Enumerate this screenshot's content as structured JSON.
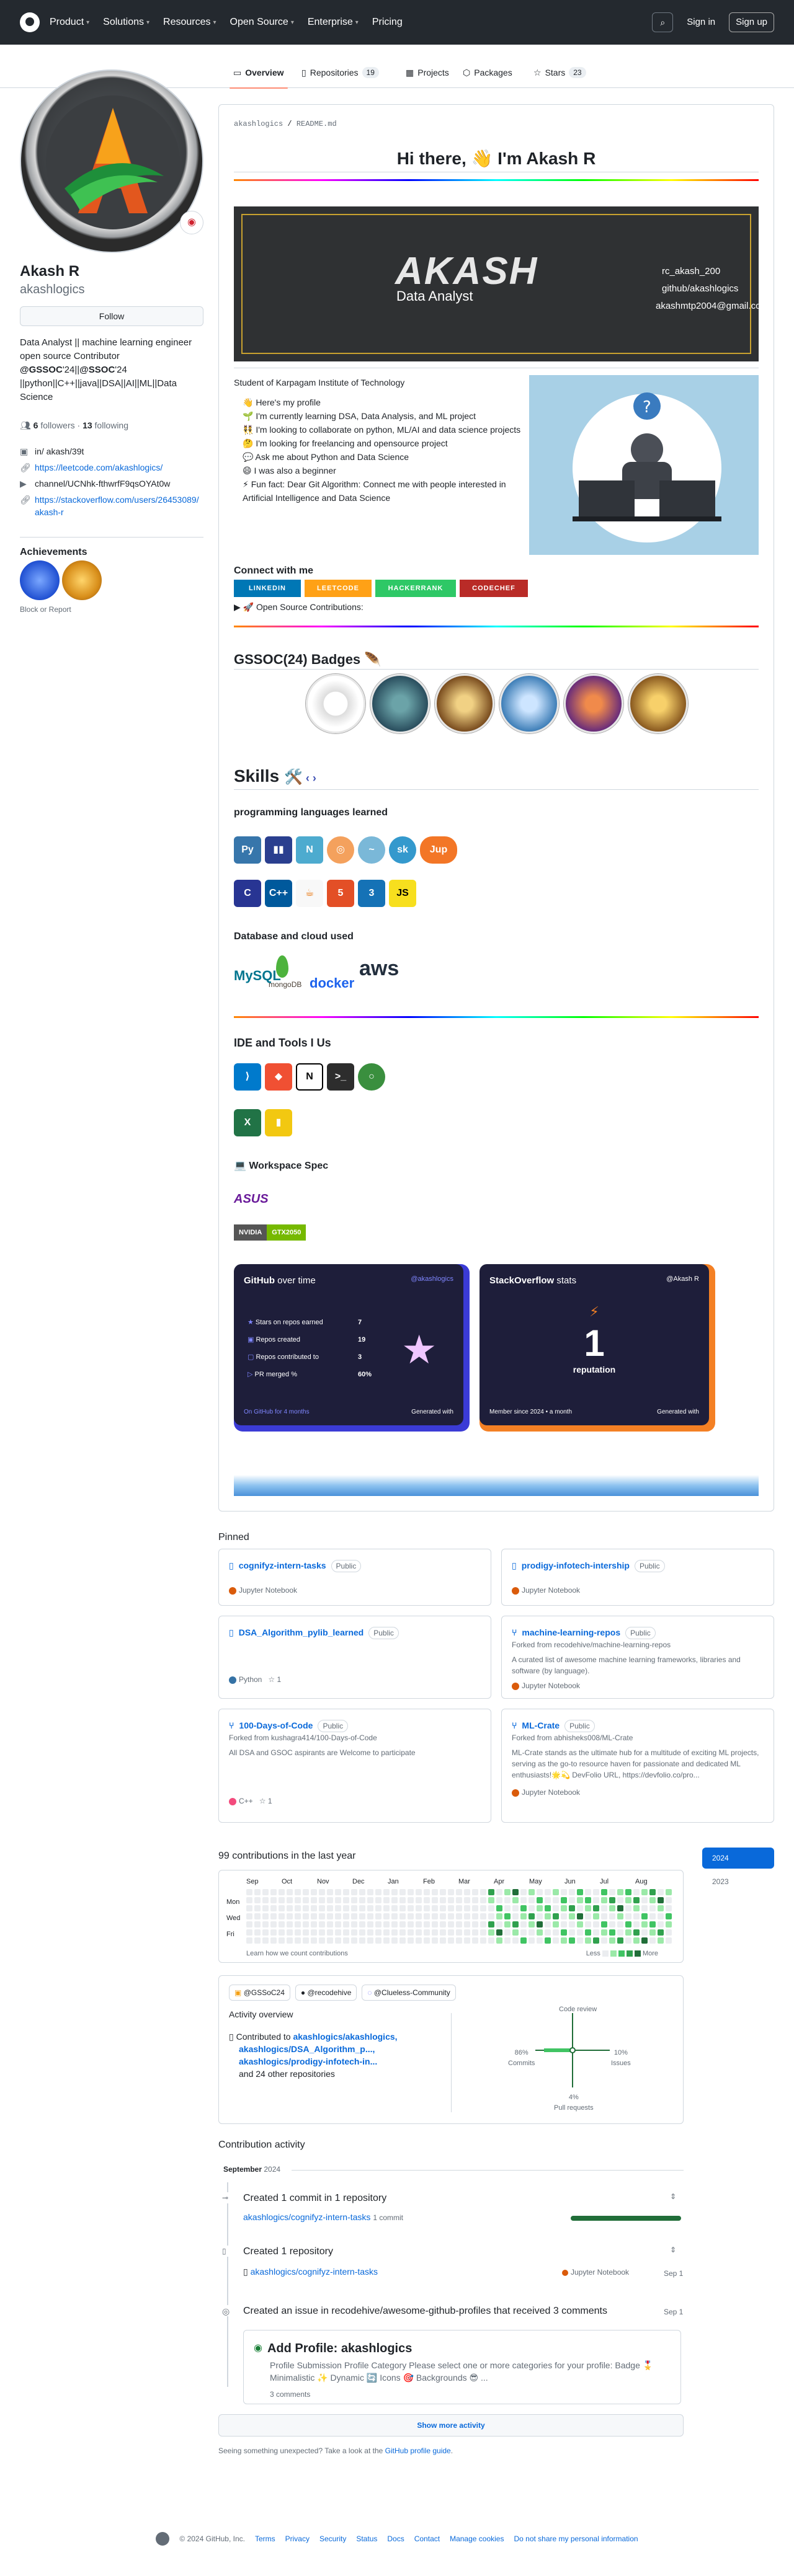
{
  "header": {
    "nav": [
      "Product",
      "Solutions",
      "Resources",
      "Open Source",
      "Enterprise",
      "Pricing"
    ],
    "sign_in": "Sign in",
    "sign_up": "Sign up"
  },
  "tabs": [
    {
      "label": "Overview"
    },
    {
      "label": "Repositories",
      "count": "19"
    },
    {
      "label": "Projects"
    },
    {
      "label": "Packages"
    },
    {
      "label": "Stars",
      "count": "23"
    }
  ],
  "profile": {
    "name": "Akash R",
    "login": "akashlogics",
    "follow": "Follow",
    "bio_l1": "Data Analyst || machine learning engineer",
    "bio_l2": "open source Contributor",
    "bio_l3a": "@GSSOC",
    "bio_l3b": "'24||",
    "bio_l3c": "@SSOC",
    "bio_l3d": "'24",
    "bio_l4": "||python||C++||java||DSA||AI||ML||Data",
    "bio_l5": "Science",
    "followers": "6",
    "followers_label": "followers",
    "following": "13",
    "following_label": "following",
    "links": [
      "in/ akash/39t",
      "https://leetcode.com/akashlogics/",
      "channel/UCNhk-fthwrfF9qsOYAt0w",
      "https://stackoverflow.com/users/26453089/",
      "akash-r"
    ],
    "achievements_title": "Achievements",
    "block": "Block or Report"
  },
  "readme": {
    "path_user": "akashlogics",
    "path_file": "README.md",
    "greeting": "Hi there,",
    "wave": "👋",
    "greeting_name": "I'm Akash R",
    "banner_name": "AKASH",
    "banner_role": "Data Analyst",
    "banner_social": [
      "rc_akash_200",
      "github/akashlogics",
      "akashmtp2004@gmail.com"
    ],
    "school": "Student of Karpagam Institute of Technology",
    "bullets": [
      "👋 Here's my profile",
      "🌱 I'm currently learning DSA, Data Analysis, and ML project",
      "👯 I'm looking to collaborate on python, ML/AI and data science projects",
      "🤔 I'm looking for freelancing and opensource project",
      "💬 Ask me about Python and Data Science",
      "😄 I was also a beginner",
      "⚡ Fun fact: Dear Git Algorithm: Connect me with people interested in Artificial Intelligence and Data Science"
    ],
    "connect": "Connect with me",
    "badges": [
      "LINKEDIN",
      "LEETCODE",
      "HACKERRANK",
      "CODECHEF"
    ],
    "osc": "▶ 🚀 Open Source Contributions:",
    "gssoc_title": "GSSOC(24) Badges",
    "skills": "Skills",
    "prog": "programming languages learned",
    "db": "Database and cloud used",
    "db_logos": [
      "MySQL",
      "mongoDB",
      "docker",
      "aws"
    ],
    "ide": "IDE and Tools I Us",
    "workspace": "💻 Workspace Spec",
    "gpu_brand": "NVIDIA",
    "gpu": "GTX2050",
    "gh_card": {
      "title": "GitHub",
      "title2": "over time",
      "user": "@akashlogics",
      "rows": [
        {
          "k": "Stars on repos earned",
          "v": "7"
        },
        {
          "k": "Repos created",
          "v": "19"
        },
        {
          "k": "Repos contributed to",
          "v": "3"
        },
        {
          "k": "PR merged %",
          "v": "60%"
        }
      ],
      "foot": "On GitHub for 4 months",
      "gen": "Generated with"
    },
    "so_card": {
      "title": "StackOverflow",
      "title2": "stats",
      "user": "@Akash R",
      "rep": "1",
      "rep_label": "reputation",
      "since": "Member since 2024 • a month",
      "gen": "Generated with"
    }
  },
  "pinned_title": "Pinned",
  "pinned": [
    {
      "name": "cognifyz-intern-tasks",
      "pub": "Public",
      "lang": "Jupyter Notebook",
      "color": "#DA5B0B"
    },
    {
      "name": "prodigy-infotech-intership",
      "pub": "Public",
      "lang": "Jupyter Notebook",
      "color": "#DA5B0B"
    },
    {
      "name": "DSA_Algorithm_pylib_learned",
      "pub": "Public",
      "lang": "Python",
      "color": "#3572A5",
      "stars": "1"
    },
    {
      "name": "machine-learning-repos",
      "pub": "Public",
      "fork": "Forked from recodehive/machine-learning-repos",
      "desc": "A curated list of awesome machine learning frameworks, libraries and software (by language).",
      "lang": "Jupyter Notebook",
      "color": "#DA5B0B"
    },
    {
      "name": "100-Days-of-Code",
      "pub": "Public",
      "fork": "Forked from kushagra414/100-Days-of-Code",
      "desc": "All DSA and GSOC aspirants are Welcome to participate",
      "lang": "C++",
      "color": "#f34b7d",
      "stars": "1"
    },
    {
      "name": "ML-Crate",
      "pub": "Public",
      "fork": "Forked from abhisheks008/ML-Crate",
      "desc": "ML-Crate stands as the ultimate hub for a multitude of exciting ML projects, serving as the go-to resource haven for passionate and dedicated ML enthusiasts!🌟💫 DevFolio URL, https://devfolio.co/pro...",
      "lang": "Jupyter Notebook",
      "color": "#DA5B0B"
    }
  ],
  "contrib": {
    "title": "99 contributions in the last year",
    "months": [
      "Sep",
      "Oct",
      "Nov",
      "Dec",
      "Jan",
      "Feb",
      "Mar",
      "Apr",
      "May",
      "Jun",
      "Jul",
      "Aug"
    ],
    "days": [
      "Mon",
      "Wed",
      "Fri"
    ],
    "learn": "Learn how we count contributions",
    "less": "Less",
    "more": "More",
    "years": [
      "2024",
      "2023"
    ]
  },
  "orgs": [
    "@GSSoC24",
    "@recodehive",
    "@Clueless-Community"
  ],
  "activity": {
    "title": "Activity overview",
    "contributed": "Contributed to",
    "repos": [
      "akashlogics/akashlogics,",
      "akashlogics/DSA_Algorithm_p...,",
      "akashlogics/prodigy-infotech-in..."
    ],
    "others": "and 24 other repositories",
    "code_review": "Code review",
    "commits_pct": "86%",
    "commits": "Commits",
    "issues_pct": "10%",
    "issues": "Issues",
    "pr_pct": "4%",
    "pr": "Pull requests"
  },
  "timeline": {
    "title": "Contribution activity",
    "month": "September",
    "year": "2024",
    "e1": "Created 1 commit in 1 repository",
    "e1_repo": "akashlogics/cognifyz-intern-tasks",
    "e1_n": "1 commit",
    "e2": "Created 1 repository",
    "e2_repo": "akashlogics/cognifyz-intern-tasks",
    "e2_lang": "Jupyter Notebook",
    "e2_date": "Sep 1",
    "e3": "Created an issue in recodehive/awesome-github-profiles that received 3 comments",
    "e3_date": "Sep 1",
    "issue_title": "Add Profile: akashlogics",
    "issue_body": "Profile Submission Profile Category Please select one or more categories for your profile: Badge 🎖️ Minimalistic ✨ Dynamic 🔄 Icons 🎯 Backgrounds 😎 ...",
    "issue_c": "3 comments",
    "more": "Show more activity",
    "unexpected": "Seeing something unexpected? Take a look at the",
    "guide": "GitHub profile guide"
  },
  "footer": [
    "© 2024 GitHub, Inc.",
    "Terms",
    "Privacy",
    "Security",
    "Status",
    "Docs",
    "Contact",
    "Manage cookies",
    "Do not share my personal information"
  ]
}
